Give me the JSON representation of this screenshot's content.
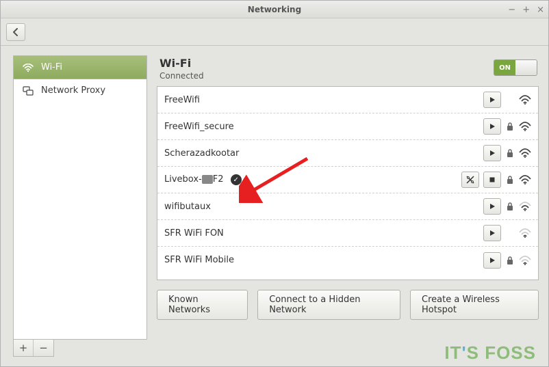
{
  "window": {
    "title": "Networking"
  },
  "sidebar": {
    "items": [
      {
        "label": "Wi-Fi",
        "icon": "wifi",
        "selected": true
      },
      {
        "label": "Network Proxy",
        "icon": "proxy",
        "selected": false
      }
    ],
    "add_label": "+",
    "remove_label": "−"
  },
  "main": {
    "title": "Wi-Fi",
    "status": "Connected",
    "switch": {
      "state": "on",
      "on_label": "ON",
      "off_label": ""
    }
  },
  "networks": [
    {
      "name": "FreeWifi",
      "connected": false,
      "secure": false,
      "signal": 3,
      "actions": [
        "play"
      ]
    },
    {
      "name": "FreeWifi_secure",
      "connected": false,
      "secure": true,
      "signal": 3,
      "actions": [
        "play"
      ]
    },
    {
      "name": "Scherazadkootar",
      "connected": false,
      "secure": true,
      "signal": 3,
      "actions": [
        "play"
      ]
    },
    {
      "name": "Livebox-",
      "suffix": "F2",
      "censored": true,
      "connected": true,
      "secure": true,
      "signal": 3,
      "actions": [
        "settings",
        "stop"
      ]
    },
    {
      "name": "wifibutaux",
      "connected": false,
      "secure": true,
      "signal": 2,
      "actions": [
        "play"
      ]
    },
    {
      "name": "SFR WiFi FON",
      "connected": false,
      "secure": false,
      "signal": 1,
      "actions": [
        "play"
      ]
    },
    {
      "name": "SFR WiFi Mobile",
      "connected": false,
      "secure": true,
      "signal": 1,
      "actions": [
        "play"
      ]
    }
  ],
  "buttons": {
    "known": "Known Networks",
    "hidden": "Connect to a Hidden Network",
    "hotspot": "Create a Wireless Hotspot"
  },
  "watermark": {
    "part1": "IT",
    "apos": "'",
    "part2": "S FOSS"
  },
  "colors": {
    "accent_green": "#8eab5f",
    "switch_green": "#7aa640"
  }
}
